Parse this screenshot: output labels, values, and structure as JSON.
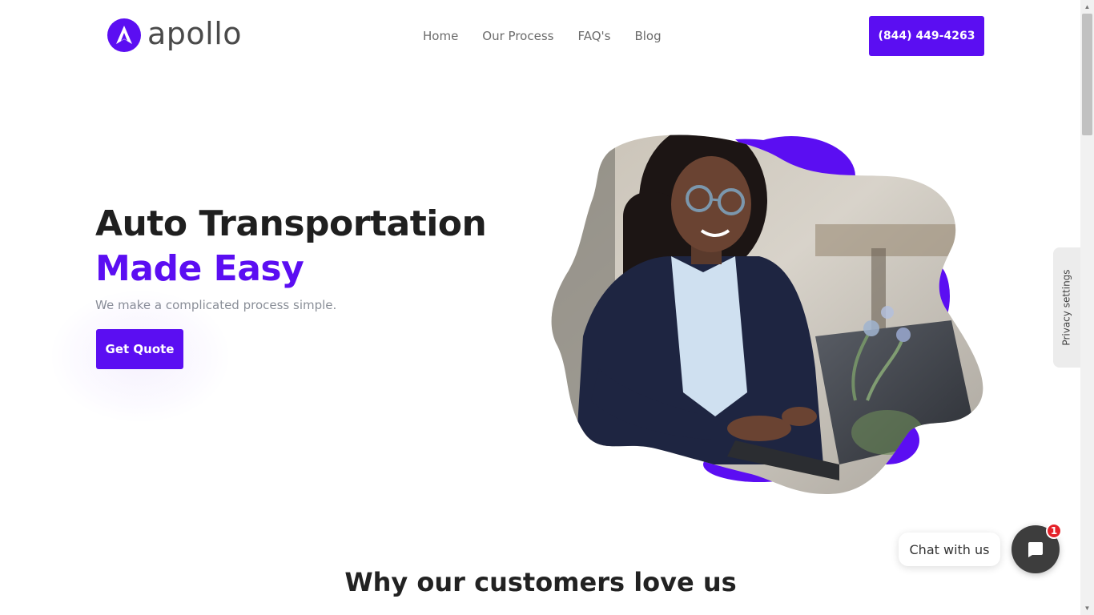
{
  "header": {
    "logo_text": "apollo",
    "nav": [
      {
        "label": "Home"
      },
      {
        "label": "Our Process"
      },
      {
        "label": "FAQ's"
      },
      {
        "label": "Blog"
      }
    ],
    "phone": "(844) 449-4263"
  },
  "hero": {
    "title_line1": "Auto Transportation",
    "title_line2": "Made Easy",
    "subtitle": "We make a complicated process simple.",
    "cta": "Get Quote",
    "image_icon": "woman-typing-laptop-photo"
  },
  "section": {
    "title": "Why our customers love us"
  },
  "privacy": {
    "label": "Privacy settings"
  },
  "chat": {
    "label": "Chat with us",
    "badge": "1",
    "icon": "chat-bubble-icon"
  },
  "colors": {
    "brand": "#5b0ef2",
    "text_dark": "#1f1f1f",
    "text_muted": "#8a8f98",
    "badge": "#e5222a"
  }
}
